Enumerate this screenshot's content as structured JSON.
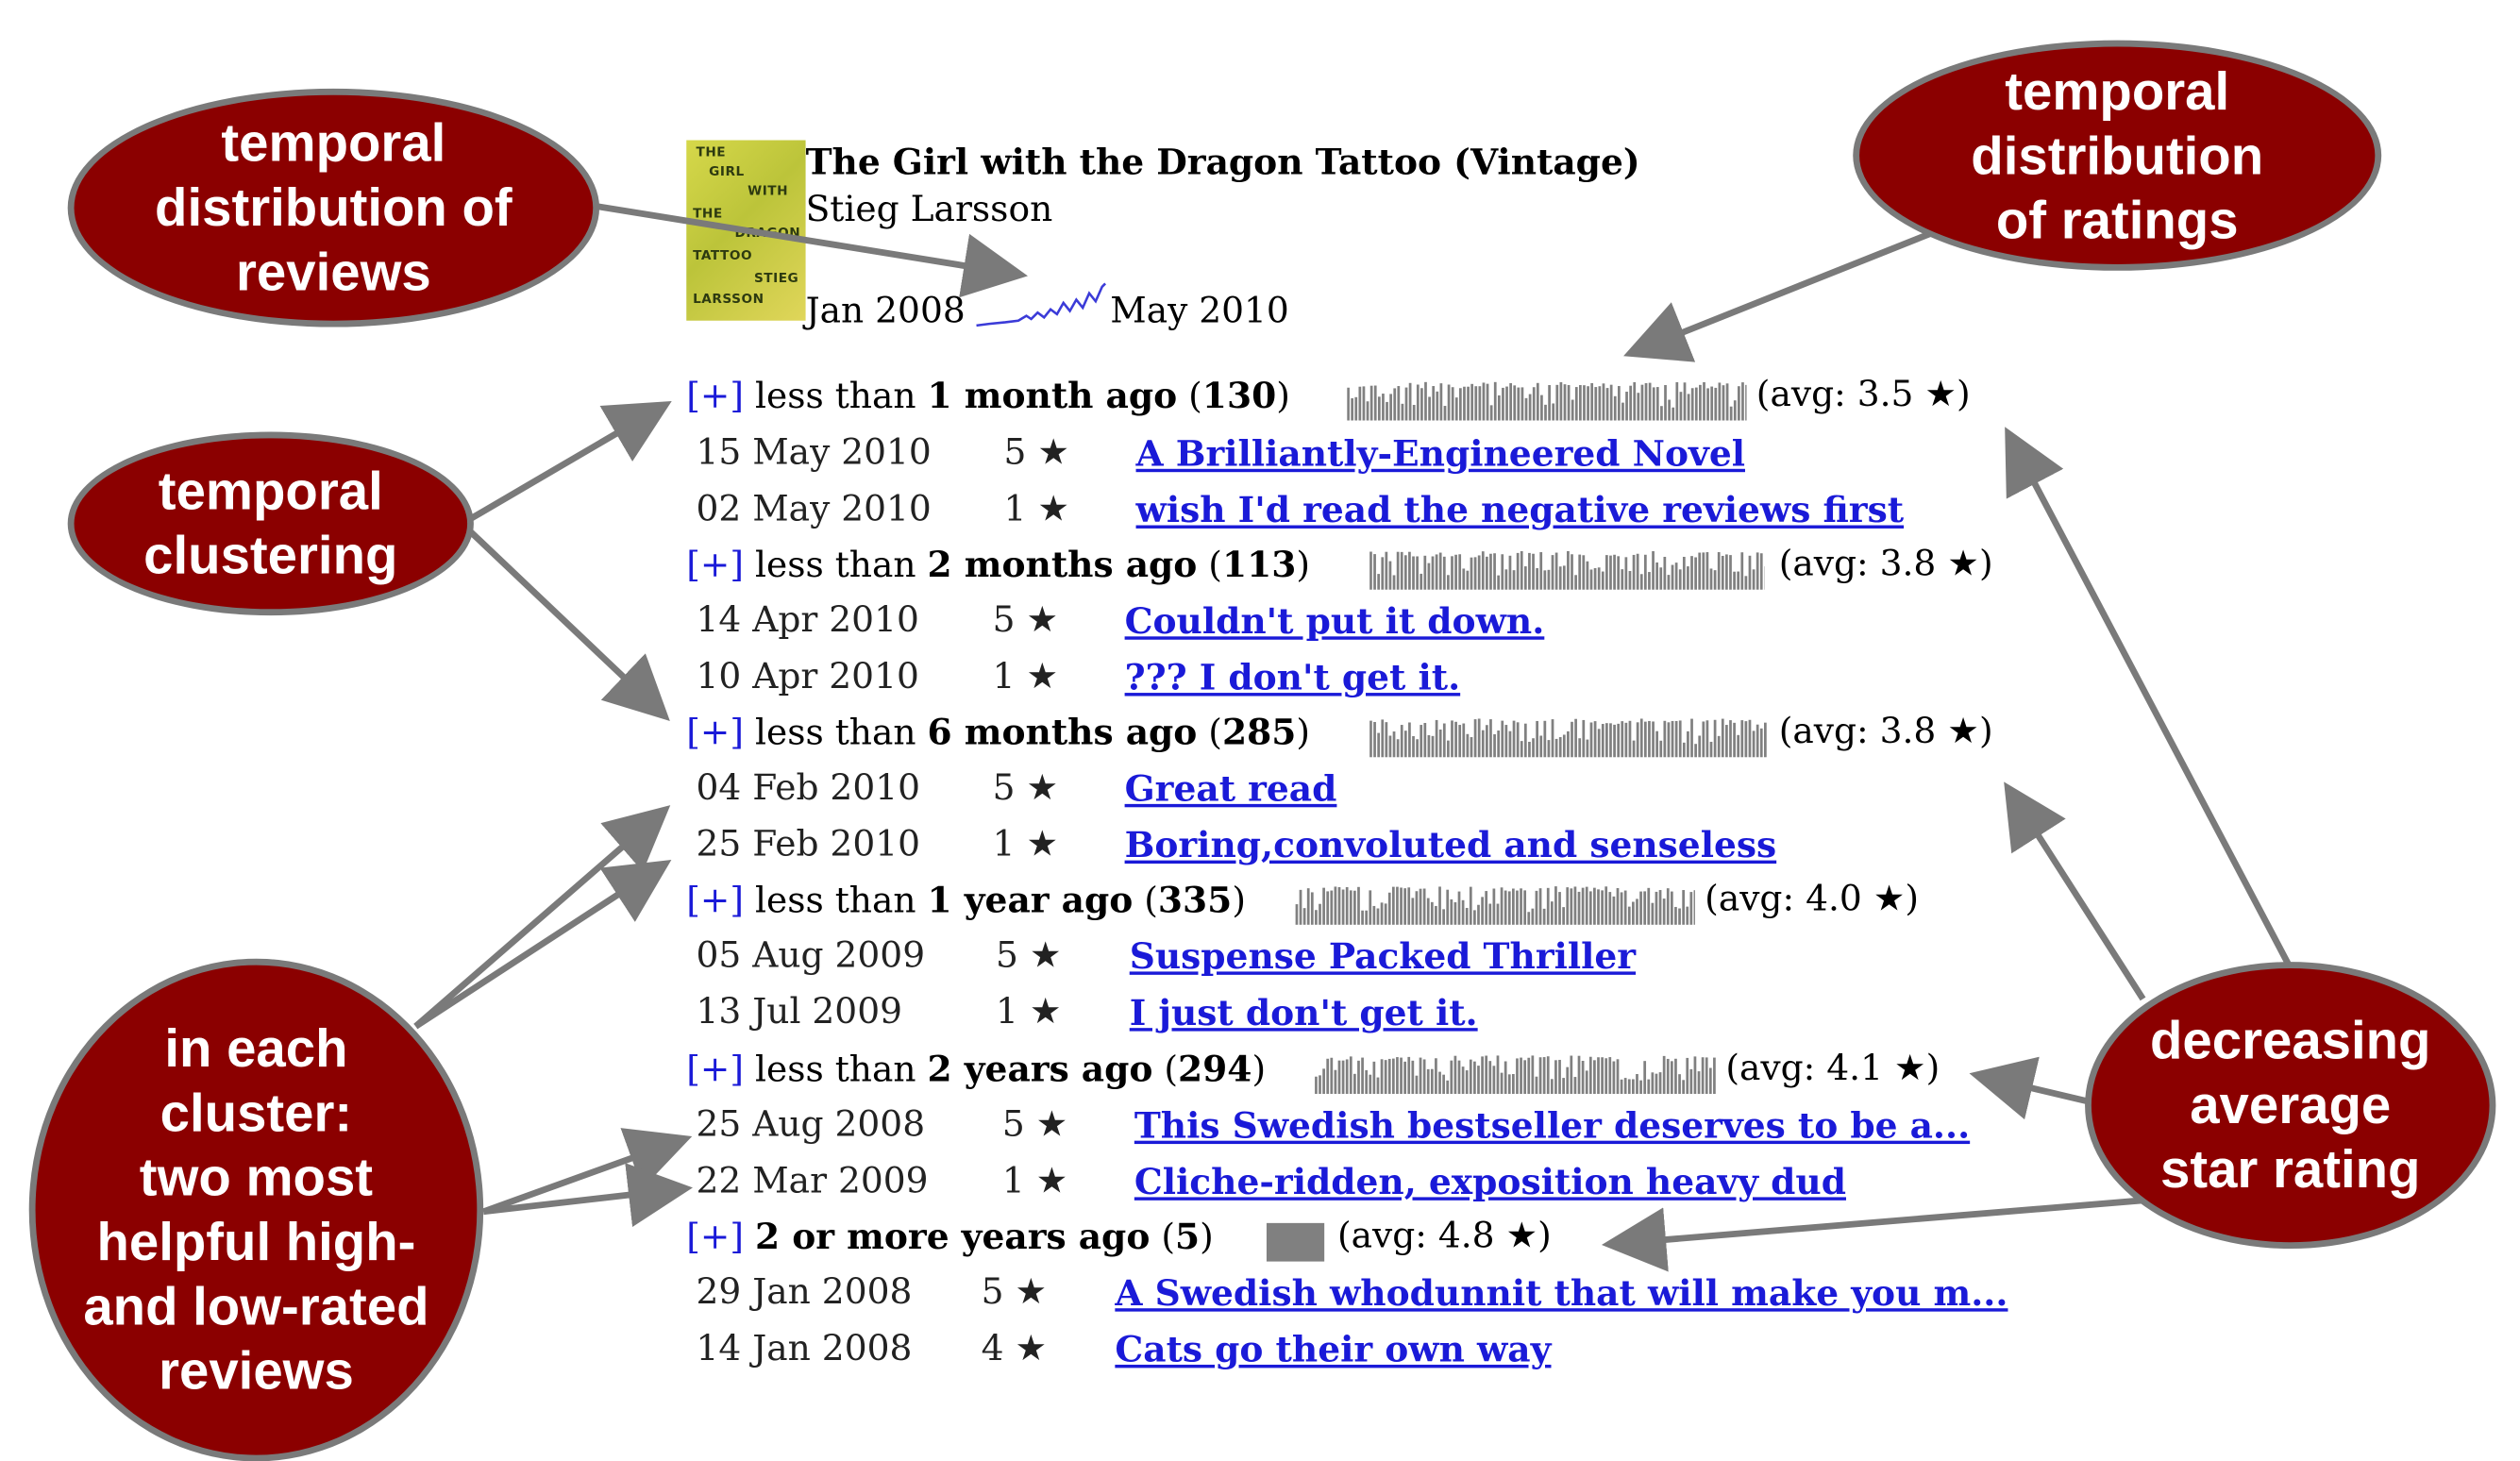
{
  "book": {
    "title": "The Girl with the Dragon Tattoo (Vintage)",
    "author": "Stieg Larsson",
    "cover_text": [
      "THE",
      "GIRL",
      "WITH",
      "THE",
      "DRAGON",
      "TATTOO",
      "STIEG",
      "LARSSON"
    ],
    "timeline_start": "Jan 2008",
    "timeline_end": "May 2010"
  },
  "clusters": [
    {
      "expand": "[+]",
      "prefix": "less than ",
      "bold": "1 month ago",
      "count_open": " (",
      "count": "130",
      "count_close": ")",
      "avg": "(avg: 3.5 ★)",
      "reviews": [
        {
          "date": "15 May 2010",
          "stars": "5 ★",
          "title": "A Brilliantly-Engineered Novel"
        },
        {
          "date": "02 May 2010",
          "stars": "1 ★",
          "title": "wish I'd read the negative reviews first"
        }
      ]
    },
    {
      "expand": "[+]",
      "prefix": "less than ",
      "bold": "2 months ago",
      "count_open": " (",
      "count": "113",
      "count_close": ")",
      "avg": "(avg: 3.8 ★)",
      "reviews": [
        {
          "date": "14 Apr 2010",
          "stars": "5 ★",
          "title": "Couldn't put it down."
        },
        {
          "date": "10 Apr 2010",
          "stars": "1 ★",
          "title": "??? I don't get it."
        }
      ]
    },
    {
      "expand": "[+]",
      "prefix": "less than ",
      "bold": "6 months ago",
      "count_open": " (",
      "count": "285",
      "count_close": ")",
      "avg": "(avg: 3.8 ★)",
      "reviews": [
        {
          "date": "04 Feb 2010",
          "stars": "5 ★",
          "title": "Great read"
        },
        {
          "date": "25 Feb 2010",
          "stars": "1 ★",
          "title": "Boring,convoluted and senseless"
        }
      ]
    },
    {
      "expand": "[+]",
      "prefix": "less than ",
      "bold": "1 year ago",
      "count_open": " (",
      "count": "335",
      "count_close": ")",
      "avg": "(avg: 4.0 ★)",
      "reviews": [
        {
          "date": "05 Aug 2009",
          "stars": "5 ★",
          "title": "Suspense Packed Thriller"
        },
        {
          "date": "13 Jul 2009",
          "stars": "1 ★",
          "title": "I just don't get it."
        }
      ]
    },
    {
      "expand": "[+]",
      "prefix": "less than ",
      "bold": "2 years ago",
      "count_open": " (",
      "count": "294",
      "count_close": ")",
      "avg": "(avg: 4.1 ★)",
      "reviews": [
        {
          "date": "25 Aug 2008",
          "stars": "5 ★",
          "title": "This Swedish bestseller deserves to be a..."
        },
        {
          "date": "22 Mar 2009",
          "stars": "1 ★",
          "title": "Cliche-ridden, exposition heavy dud"
        }
      ]
    },
    {
      "expand": "[+]",
      "prefix": "",
      "bold": "2 or more years ago",
      "count_open": " (",
      "count": "5",
      "count_close": ")",
      "avg": "(avg: 4.8 ★)",
      "reviews": [
        {
          "date": "29 Jan 2008",
          "stars": "5 ★",
          "title": "A Swedish whodunnit that will make you m..."
        },
        {
          "date": "14 Jan 2008",
          "stars": "4 ★",
          "title": "Cats go their own way"
        }
      ]
    }
  ],
  "annotations": {
    "reviews_distribution": "temporal\ndistribution of\nreviews",
    "ratings_distribution": "temporal\ndistribution\nof ratings",
    "clustering": "temporal\nclustering",
    "helpful": "in each\ncluster:\ntwo most\nhelpful high-\nand low-rated\nreviews",
    "decreasing": "decreasing\naverage\nstar rating"
  },
  "colors": {
    "bubble": "#8b0000",
    "arrow": "#7a7a7a",
    "link": "#1a1ad8",
    "histogram": "#808080",
    "sparkline": "#3b3bd8"
  }
}
